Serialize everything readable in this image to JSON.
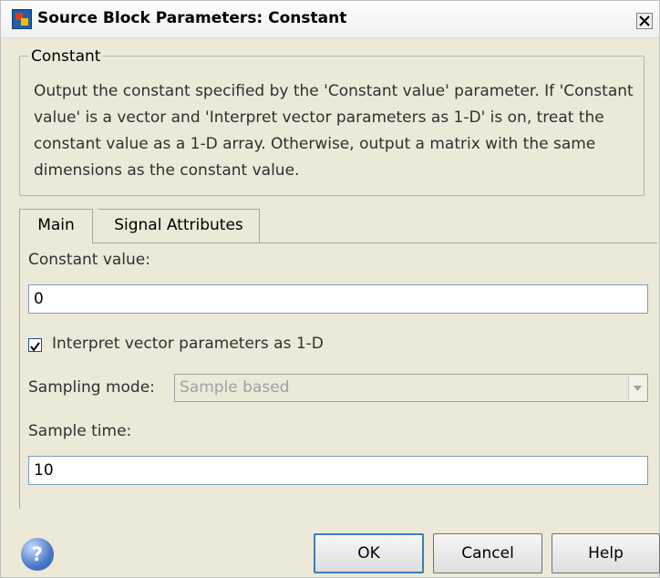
{
  "window": {
    "title": "Source Block Parameters: Constant",
    "close_label": "X"
  },
  "group": {
    "legend": "Constant",
    "description": "Output the constant specified by the 'Constant value' parameter. If 'Constant value' is a vector and 'Interpret vector parameters as 1-D' is on, treat the constant value as a 1-D array. Otherwise, output a matrix with the same dimensions as the constant value."
  },
  "tabs": [
    {
      "label": "Main",
      "active": true
    },
    {
      "label": "Signal Attributes",
      "active": false
    }
  ],
  "main": {
    "constant_value_label": "Constant value:",
    "constant_value": "0",
    "interpret_label": "Interpret vector parameters as 1-D",
    "interpret_checked": true,
    "sampling_mode_label": "Sampling mode:",
    "sampling_mode_value": "Sample based",
    "sampling_mode_disabled": true,
    "sample_time_label": "Sample time:",
    "sample_time": "10"
  },
  "buttons": {
    "ok": "OK",
    "cancel": "Cancel",
    "help": "Help"
  },
  "icons": {
    "app": "simulink-block-icon",
    "help": "help-question-icon",
    "close": "close-icon",
    "dropdown": "chevron-down-icon"
  },
  "colors": {
    "dialog_bg": "#ece9d8",
    "input_border": "#7f9db9",
    "help_blue": "#4a78c8"
  }
}
